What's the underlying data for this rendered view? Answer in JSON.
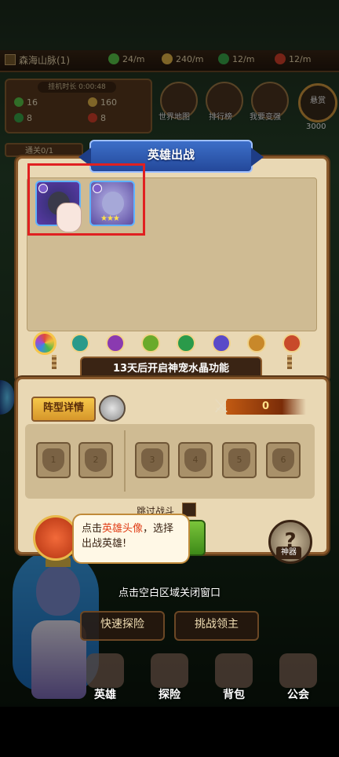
{
  "topbar": {
    "location": "森海山脉(1)",
    "resources": [
      {
        "icon": "green-potion-icon",
        "value": "24/m",
        "color": "#5ac84a"
      },
      {
        "icon": "gold-coin-icon",
        "value": "240/m",
        "color": "#e8b84a"
      },
      {
        "icon": "clover-icon",
        "value": "12/m",
        "color": "#3aa84a"
      },
      {
        "icon": "red-gem-icon",
        "value": "12/m",
        "color": "#d8402a"
      }
    ]
  },
  "idle": {
    "title": "挂机时长 0:00:48",
    "values": [
      {
        "icon": "green-potion-icon",
        "value": "16",
        "color": "#5ac84a"
      },
      {
        "icon": "gold-coin-icon",
        "value": "160",
        "color": "#e8b84a"
      },
      {
        "icon": "clover-icon",
        "value": "8",
        "color": "#3aa84a"
      },
      {
        "icon": "red-gem-icon",
        "value": "8",
        "color": "#d8402a"
      }
    ]
  },
  "menu": {
    "world_map": "世界地图",
    "ranking": "排行榜",
    "stronger": "我要变强",
    "reward_label": "悬赏",
    "reward_value": "3000"
  },
  "pass": "通关0/1",
  "hero_panel": {
    "title": "英雄出战",
    "heroes": [
      {
        "name": "hero-dark-mage",
        "stars": ""
      },
      {
        "name": "hero-pale-elf",
        "stars": "★★★"
      }
    ],
    "notice": "13天后开启神宠水晶功能"
  },
  "formation": {
    "detail_label": "阵型详情",
    "power": "0",
    "slots": [
      "1",
      "2",
      "3",
      "4",
      "5",
      "6"
    ],
    "skip_label": "跳过战斗"
  },
  "artifact_label": "神器",
  "bubble": {
    "pre": "点击",
    "highlight": "英雄头像",
    "post": "，选择出战英雄!"
  },
  "close_hint": "点击空白区域关闭窗口",
  "buttons": {
    "quick_explore": "快速探险",
    "challenge_boss": "挑战领主"
  },
  "nav": {
    "hero": "英雄",
    "explore": "探险",
    "bag": "背包",
    "guild": "公会"
  }
}
